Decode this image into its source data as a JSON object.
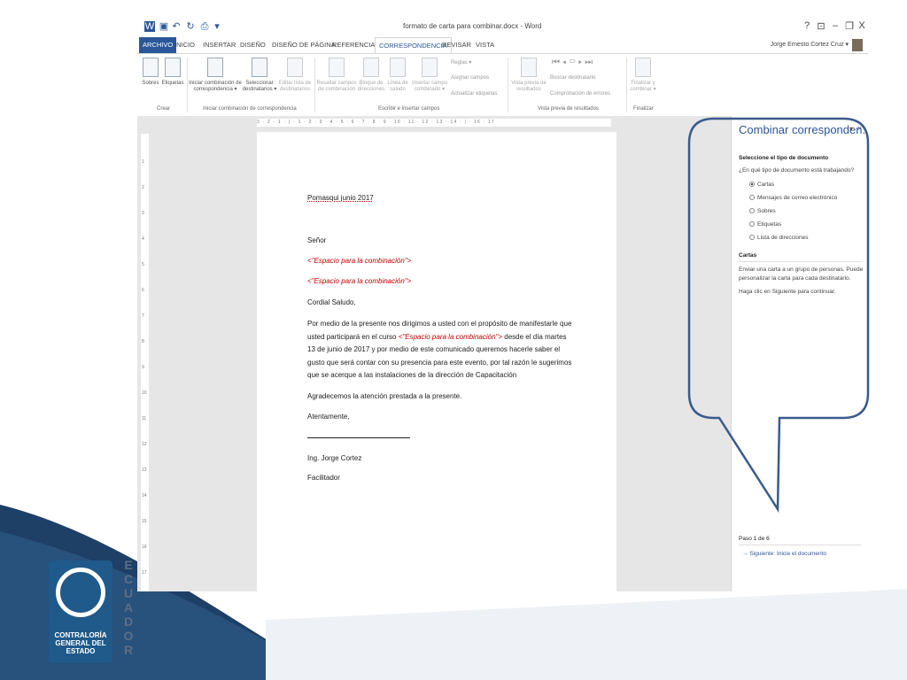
{
  "titlebar": {
    "doc_title": "formato de carta para combinar.docx - Word",
    "help": "?",
    "restore_ribbon": "⊡",
    "minimize": "‒",
    "maximize": "❐",
    "close": "X"
  },
  "menu": {
    "tabs": [
      "ARCHIVO",
      "INICIO",
      "INSERTAR",
      "DISEÑO",
      "DISEÑO DE PÁGINA",
      "REFERENCIAS",
      "CORRESPONDENCIA",
      "REVISAR",
      "VISTA"
    ],
    "active": "CORRESPONDENCIA",
    "user": "Jorge Ernesto Cortez Cruz ▾"
  },
  "ribbon": {
    "sobres": "Sobres",
    "etiquetas": "Etiquetas",
    "iniciar": "Iniciar combinación de correspondencia ▾",
    "seleccionar": "Seleccionar destinatarios ▾",
    "editar": "Editar lista de destinatarios",
    "resaltar": "Resaltar campos de combinación",
    "bloque": "Bloque de direcciones",
    "linea": "Línea de saludo",
    "insertar_campo": "Insertar campo combinado ▾",
    "reglas": "Reglas ▾",
    "asignar": "Asignar campos",
    "actualizar": "Actualizar etiquetas",
    "vista_previa": "Vista previa de resultados",
    "buscar": "Buscar destinatario",
    "comprobacion": "Comprobación de errores",
    "finalizar": "Finalizar y combinar ▾",
    "groups": {
      "crear": "Crear",
      "iniciar": "Iniciar combinación de correspondencia",
      "escribir": "Escribir e insertar campos",
      "vista": "Vista previa de resultados",
      "finalizar": "Finalizar"
    }
  },
  "ruler": {
    "h": "3 · 2 · 1 · | · 1 · 2 · 3 · 4 · 5 · 6 · 7 · 8 · 9 · 10 · 11 · 12 · 13 · 14 · | · 16 · 17"
  },
  "letter": {
    "place": "Pomasqui  junio 2017",
    "greeting_to": "Señor",
    "merge1": "<\"Espacio para la combinación\">",
    "merge2": "<\"Espacio para la combinación\">",
    "salutation": "Cordial Saludo,",
    "para_a": "Por medio de la presente nos dirigimos a usted con el propósito de manifestarle que usted participará en el curso ",
    "para_merge": "<\"Espacio para la combinación\">",
    "para_b": "  desde el día martes 13 de junio de 2017 y por medio de este comunicado queremos hacerle saber el gusto que será contar con su presencia para este evento, por tal razón le sugerimos que se acerque  a las instalaciones de la dirección de Capacitación",
    "thanks": "Agradecemos la atención prestada a la presente.",
    "closing": "Atentamente,",
    "signer": "Ing. Jorge Cortez",
    "role": "Facilitador"
  },
  "pane": {
    "title": "Combinar corresponden...",
    "section1": "Seleccione el tipo de documento",
    "question": "¿En qué tipo de documento está trabajando?",
    "options": [
      "Cartas",
      "Mensajes de correo electrónico",
      "Sobres",
      "Etiquetas",
      "Lista de direcciones"
    ],
    "section2": "Cartas",
    "desc1": "Enviar una carta a un grupo de personas. Puede",
    "desc2": "personalizar la carta para cada destinatario.",
    "desc3": "Haga clic en Siguiente para continuar.",
    "step": "Paso 1 de 6",
    "next": "Siguiente: Inicie el documento"
  },
  "logo": {
    "text": "CONTRALORÍA GENERAL DEL ESTADO",
    "country": "ECUADOR"
  },
  "colors": {
    "word_blue": "#2b579a",
    "merge_red": "#c00000",
    "callout_blue": "#3a5a8c",
    "band_dark": "#1e3f66"
  }
}
